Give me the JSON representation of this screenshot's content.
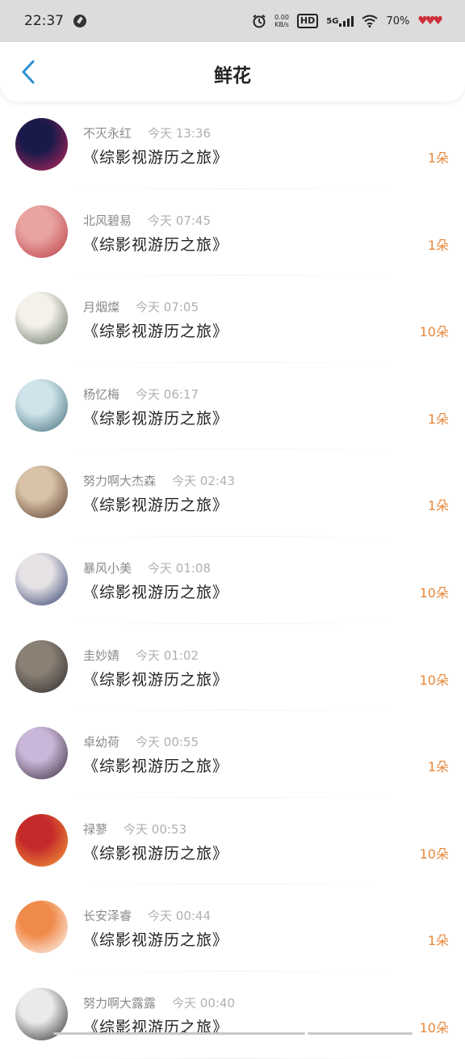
{
  "status": {
    "time": "22:37",
    "speed": "0.00\nKB/s",
    "hd": "HD",
    "network": "5G",
    "battery": "70%"
  },
  "header": {
    "title": "鲜花"
  },
  "items": [
    {
      "name": "不灭永红",
      "time": "今天 13:36",
      "book": "《综影视游历之旅》",
      "count": "1朵",
      "avatar_colors": [
        "#1a1a4a",
        "#c0265c"
      ]
    },
    {
      "name": "北风碧易",
      "time": "今天 07:45",
      "book": "《综影视游历之旅》",
      "count": "1朵",
      "avatar_colors": [
        "#e9a3a0",
        "#b93a46"
      ]
    },
    {
      "name": "月烟燦",
      "time": "今天 07:05",
      "book": "《综影视游历之旅》",
      "count": "10朵",
      "avatar_colors": [
        "#f4f1ea",
        "#5a6a5a"
      ]
    },
    {
      "name": "杨忆梅",
      "time": "今天 06:17",
      "book": "《综影视游历之旅》",
      "count": "1朵",
      "avatar_colors": [
        "#cfe3ea",
        "#3e6b77"
      ]
    },
    {
      "name": "努力啊大杰森",
      "time": "今天 02:43",
      "book": "《综影视游历之旅》",
      "count": "1朵",
      "avatar_colors": [
        "#d8c3a8",
        "#5a3a2a"
      ]
    },
    {
      "name": "暴风小美",
      "time": "今天 01:08",
      "book": "《综影视游历之旅》",
      "count": "10朵",
      "avatar_colors": [
        "#e6e2e6",
        "#2a3a6a"
      ]
    },
    {
      "name": "圭妙婧",
      "time": "今天 01:02",
      "book": "《综影视游历之旅》",
      "count": "10朵",
      "avatar_colors": [
        "#8a8074",
        "#2a2a2a"
      ]
    },
    {
      "name": "卓幼荷",
      "time": "今天 00:55",
      "book": "《综影视游历之旅》",
      "count": "1朵",
      "avatar_colors": [
        "#c9b6d8",
        "#3a2a3a"
      ]
    },
    {
      "name": "禄蓼",
      "time": "今天 00:53",
      "book": "《综影视游历之旅》",
      "count": "10朵",
      "avatar_colors": [
        "#c52a2a",
        "#f5a23a"
      ]
    },
    {
      "name": "长安泽睿",
      "time": "今天 00:44",
      "book": "《综影视游历之旅》",
      "count": "1朵",
      "avatar_colors": [
        "#f08a4a",
        "#ffffff"
      ]
    },
    {
      "name": "努力啊大露露",
      "time": "今天 00:40",
      "book": "《综影视游历之旅》",
      "count": "10朵",
      "avatar_colors": [
        "#eaeaea",
        "#2a2a2a"
      ]
    }
  ],
  "colors": {
    "accent": "#2a90d8",
    "count": "#e8873a"
  }
}
